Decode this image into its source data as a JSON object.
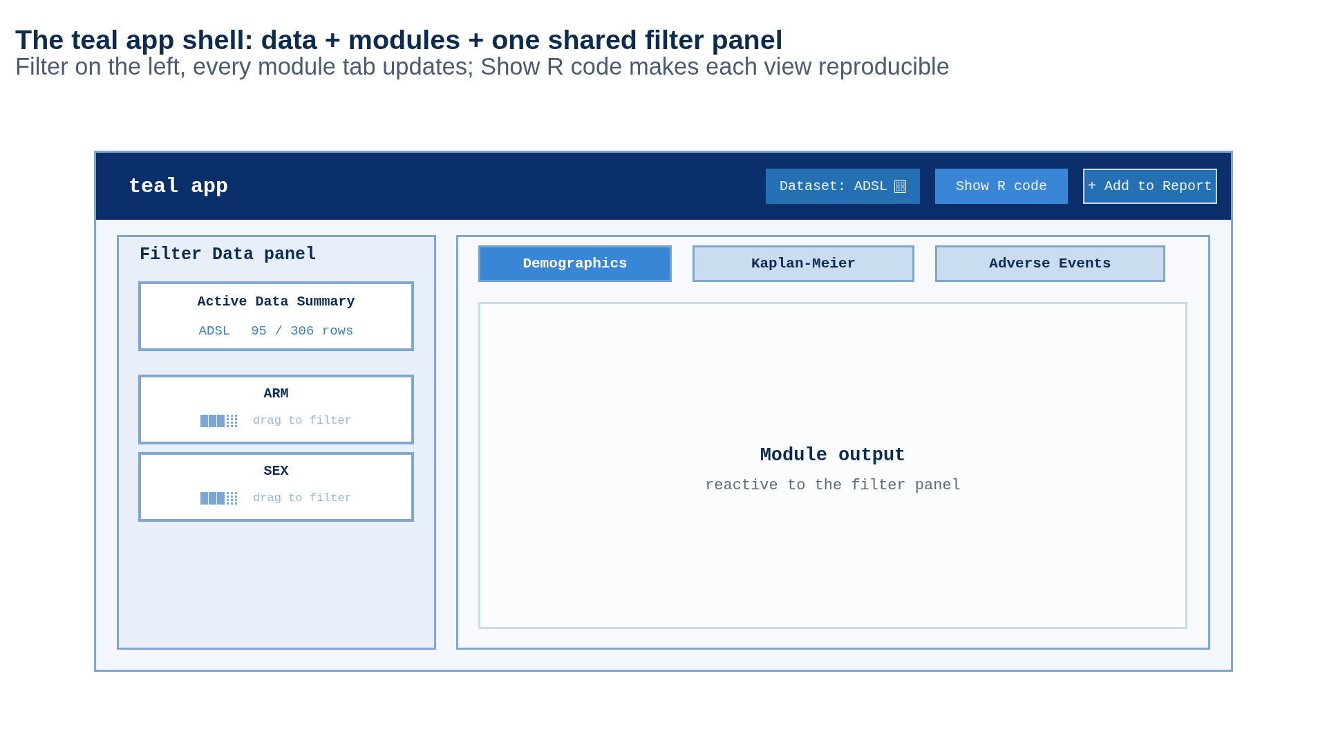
{
  "title": "The teal app shell: data + modules + one shared filter panel",
  "subtitle": "Filter on the left, every module tab updates; Show R code makes each view reproducible",
  "app": {
    "title": "teal app",
    "header_buttons": [
      {
        "label": "Dataset: ADSL",
        "kind": "dropdown"
      },
      {
        "label": "Show R code",
        "kind": "primary"
      },
      {
        "label": "+ Add to Report",
        "kind": "outline"
      }
    ],
    "filter_panel": {
      "title": "Filter Data panel",
      "summary": {
        "title": "Active Data Summary",
        "dataset": "ADSL",
        "rows": "95 / 306 rows"
      },
      "filters": [
        {
          "variable": "ARM",
          "hint": "drag to filter"
        },
        {
          "variable": "SEX",
          "hint": "drag to filter"
        }
      ]
    },
    "tabs": [
      {
        "label": "Demographics",
        "selected": true
      },
      {
        "label": "Kaplan-Meier",
        "selected": false
      },
      {
        "label": "Adverse Events",
        "selected": false
      }
    ],
    "output": {
      "title": "Module output",
      "subtitle": "reactive to the filter panel"
    }
  }
}
